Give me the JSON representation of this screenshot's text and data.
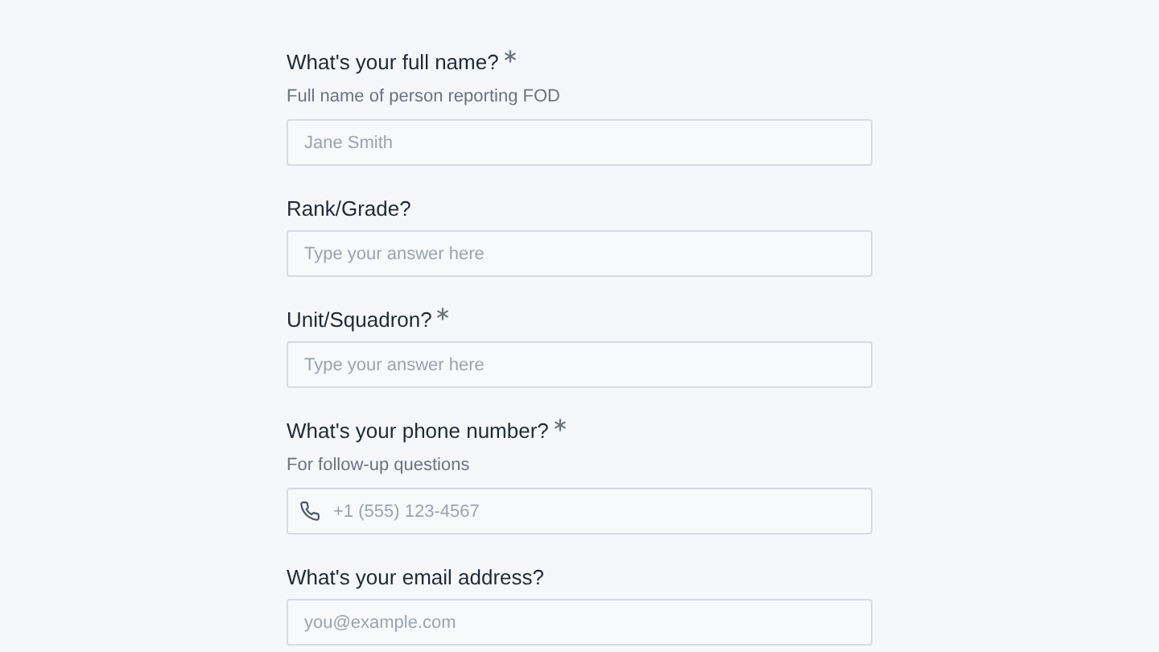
{
  "questions": [
    {
      "kind": "text",
      "label": "What's your full name?",
      "required": true,
      "help": "Full name of person reporting FOD",
      "placeholder": "Jane Smith"
    },
    {
      "kind": "text",
      "label": "Rank/Grade?",
      "required": false,
      "placeholder": "Type your answer here"
    },
    {
      "kind": "text",
      "label": "Unit/Squadron?",
      "required": true,
      "placeholder": "Type your answer here"
    },
    {
      "kind": "phone",
      "label": "What's your phone number?",
      "required": true,
      "help": "For follow-up questions",
      "placeholder": "+1 (555) 123-4567"
    },
    {
      "kind": "email",
      "label": "What's your email address?",
      "required": false,
      "placeholder": "you@example.com"
    }
  ]
}
